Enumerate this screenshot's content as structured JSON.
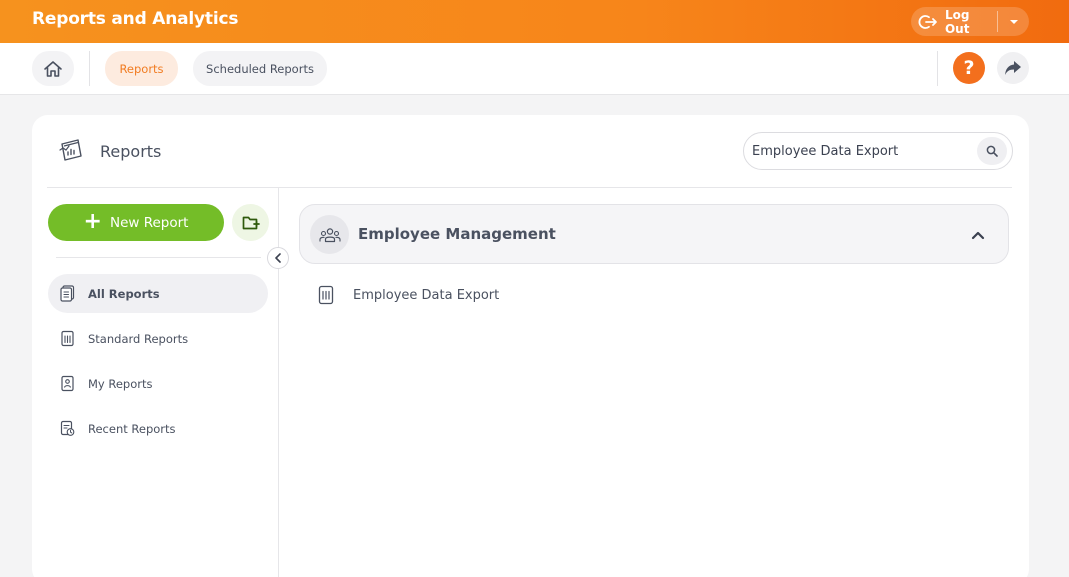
{
  "header": {
    "app_title": "Reports and Analytics",
    "logout_label": "Log Out",
    "brand_color": "#f6921e"
  },
  "nav": {
    "home_icon": "home-icon",
    "tabs": [
      {
        "label": "Reports",
        "active": true
      },
      {
        "label": "Scheduled Reports",
        "active": false
      }
    ],
    "help_label": "?",
    "share_icon": "share-arrow-icon"
  },
  "card": {
    "title": "Reports",
    "search": {
      "value": "Employee Data Export",
      "placeholder": "Search"
    }
  },
  "sidebar": {
    "new_report_label": "New Report",
    "items": [
      {
        "label": "All Reports",
        "icon": "all-reports-icon",
        "active": true
      },
      {
        "label": "Standard Reports",
        "icon": "standard-reports-icon",
        "active": false
      },
      {
        "label": "My Reports",
        "icon": "my-reports-icon",
        "active": false
      },
      {
        "label": "Recent Reports",
        "icon": "recent-reports-icon",
        "active": false
      }
    ]
  },
  "main": {
    "group": {
      "title": "Employee Management",
      "expanded": true,
      "reports": [
        {
          "label": "Employee Data Export"
        }
      ]
    }
  },
  "colors": {
    "accent": "#f36f1d",
    "green": "#74bd28"
  }
}
